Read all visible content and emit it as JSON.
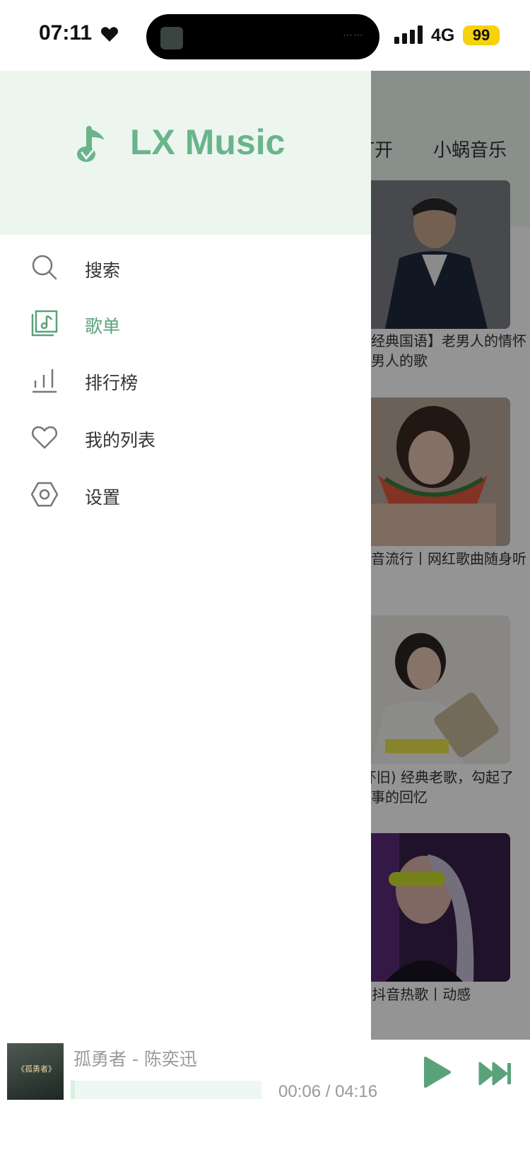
{
  "status": {
    "time": "07:11",
    "network": "4G",
    "battery": "99"
  },
  "app": {
    "name": "LX Music"
  },
  "nav": [
    {
      "label": "搜索",
      "icon": "search-icon",
      "active": false
    },
    {
      "label": "歌单",
      "icon": "playlist-icon",
      "active": true
    },
    {
      "label": "排行榜",
      "icon": "chart-bars-icon",
      "active": false
    },
    {
      "label": "我的列表",
      "icon": "heart-icon",
      "active": false
    },
    {
      "label": "设置",
      "icon": "settings-icon",
      "active": false
    }
  ],
  "background": {
    "tabs": [
      "打开",
      "小蜗音乐"
    ],
    "cards": [
      {
        "title": "【经典国语】老男人的情怀老男人的歌"
      },
      {
        "title": "抖音流行丨网红歌曲随身听"
      },
      {
        "title": "(怀旧) 经典老歌，勾起了往事的回忆"
      },
      {
        "title": "DJ抖音热歌丨动感"
      }
    ]
  },
  "player": {
    "title": "孤勇者 - 陈奕迅",
    "time": "00:06 / 04:16",
    "progress": 0.024,
    "cover_text": "《孤勇者》"
  },
  "colors": {
    "accent": "#5aa27a",
    "header_bg": "#ecf6ef",
    "battery": "#f5d20a"
  }
}
